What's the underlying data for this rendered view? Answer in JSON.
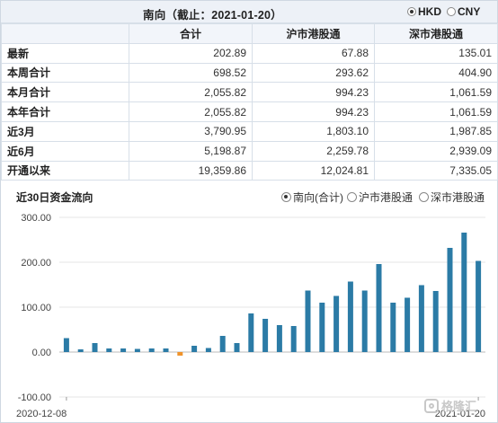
{
  "header": {
    "title": "南向（截止：2021-01-20）",
    "currency_options": [
      {
        "label": "HKD",
        "selected": true
      },
      {
        "label": "CNY",
        "selected": false
      }
    ]
  },
  "summary_table": {
    "columns": [
      "合计",
      "沪市港股通",
      "深市港股通"
    ],
    "rows": [
      {
        "label": "最新",
        "values": [
          "202.89",
          "67.88",
          "135.01"
        ]
      },
      {
        "label": "本周合计",
        "values": [
          "698.52",
          "293.62",
          "404.90"
        ]
      },
      {
        "label": "本月合计",
        "values": [
          "2,055.82",
          "994.23",
          "1,061.59"
        ]
      },
      {
        "label": "本年合计",
        "values": [
          "2,055.82",
          "994.23",
          "1,061.59"
        ]
      },
      {
        "label": "近3月",
        "values": [
          "3,790.95",
          "1,803.10",
          "1,987.85"
        ]
      },
      {
        "label": "近6月",
        "values": [
          "5,198.87",
          "2,259.78",
          "2,939.09"
        ]
      },
      {
        "label": "开通以来",
        "values": [
          "19,359.86",
          "12,024.81",
          "7,335.05"
        ]
      }
    ]
  },
  "chart_section": {
    "title": "近30日资金流向",
    "legend": [
      {
        "label": "南向(合计)",
        "selected": true
      },
      {
        "label": "沪市港股通",
        "selected": false
      },
      {
        "label": "深市港股通",
        "selected": false
      }
    ]
  },
  "colors": {
    "positive": "#2b7ba6",
    "negative": "#f0932b",
    "grid": "#e6e6e6"
  },
  "chart_data": {
    "type": "bar",
    "series": [
      {
        "name": "南向(合计)",
        "values": [
          31,
          6,
          20,
          8,
          8,
          7,
          8,
          8,
          -8,
          14,
          9,
          36,
          20,
          86,
          74,
          60,
          58,
          137,
          110,
          125,
          157,
          137,
          196,
          110,
          121,
          149,
          136,
          232,
          266,
          203
        ]
      }
    ],
    "x_tick_labels": [
      "2020-12-08",
      "2021-01-20"
    ],
    "y_ticks": [
      "300.00",
      "200.00",
      "100.00",
      "0.00",
      "-100.00"
    ],
    "ylim": [
      -100,
      300
    ]
  },
  "watermark": {
    "text": "格隆汇"
  }
}
